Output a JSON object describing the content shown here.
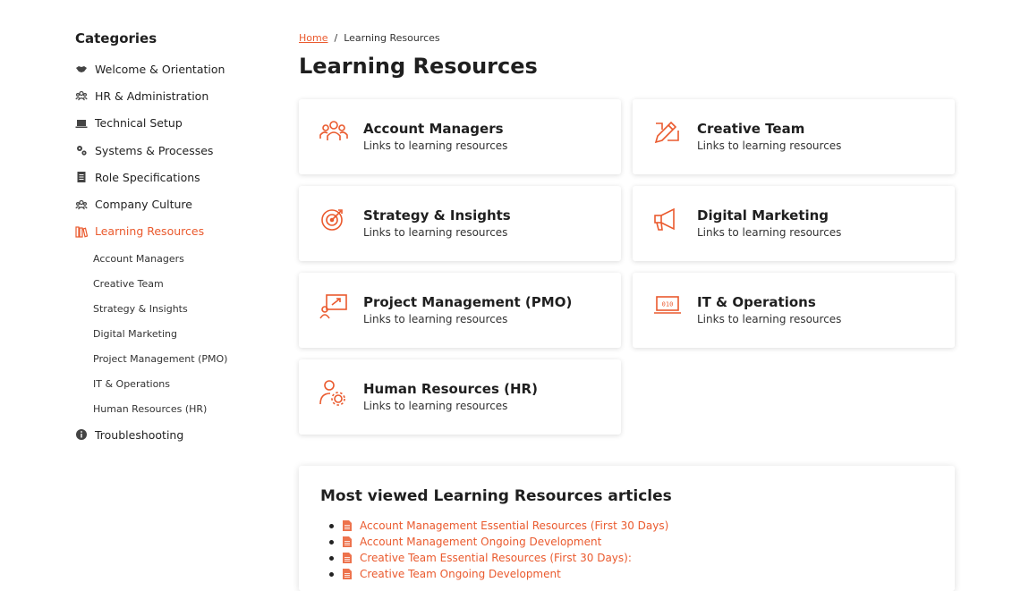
{
  "sidebar": {
    "heading": "Categories",
    "items": [
      {
        "label": "Welcome & Orientation",
        "icon": "handshake-icon"
      },
      {
        "label": "HR & Administration",
        "icon": "people-icon"
      },
      {
        "label": "Technical Setup",
        "icon": "laptop-icon"
      },
      {
        "label": "Systems & Processes",
        "icon": "gears-icon"
      },
      {
        "label": "Role Specifications",
        "icon": "document-icon"
      },
      {
        "label": "Company Culture",
        "icon": "group-icon"
      },
      {
        "label": "Learning Resources",
        "icon": "books-icon"
      }
    ],
    "subitems": [
      "Account Managers",
      "Creative Team",
      "Strategy & Insights",
      "Digital Marketing",
      "Project Management (PMO)",
      "IT & Operations",
      "Human Resources (HR)"
    ],
    "trouble": {
      "label": "Troubleshooting",
      "icon": "info-icon"
    }
  },
  "breadcrumb": {
    "home": "Home",
    "sep": "/",
    "current": "Learning Resources"
  },
  "page_title": "Learning Resources",
  "cards": [
    {
      "title": "Account Managers",
      "subtitle": "Links to learning resources",
      "icon": "team-icon"
    },
    {
      "title": "Creative Team",
      "subtitle": "Links to learning resources",
      "icon": "pencil-ruler-icon"
    },
    {
      "title": "Strategy & Insights",
      "subtitle": "Links to learning resources",
      "icon": "target-icon"
    },
    {
      "title": "Digital Marketing",
      "subtitle": "Links to learning resources",
      "icon": "megaphone-icon"
    },
    {
      "title": "Project Management (PMO)",
      "subtitle": "Links to learning resources",
      "icon": "presentation-icon"
    },
    {
      "title": "IT & Operations",
      "subtitle": "Links to learning resources",
      "icon": "laptop-code-icon"
    },
    {
      "title": "Human Resources (HR)",
      "subtitle": "Links to learning resources",
      "icon": "user-gear-icon"
    }
  ],
  "most_viewed": {
    "heading": "Most viewed Learning Resources articles",
    "articles": [
      "Account Management Essential Resources (First 30 Days)",
      "Account Management Ongoing Development",
      "Creative Team Essential Resources (First 30 Days):",
      "Creative Team Ongoing Development"
    ]
  },
  "colors": {
    "accent": "#ea5a2e",
    "text": "#222222"
  }
}
